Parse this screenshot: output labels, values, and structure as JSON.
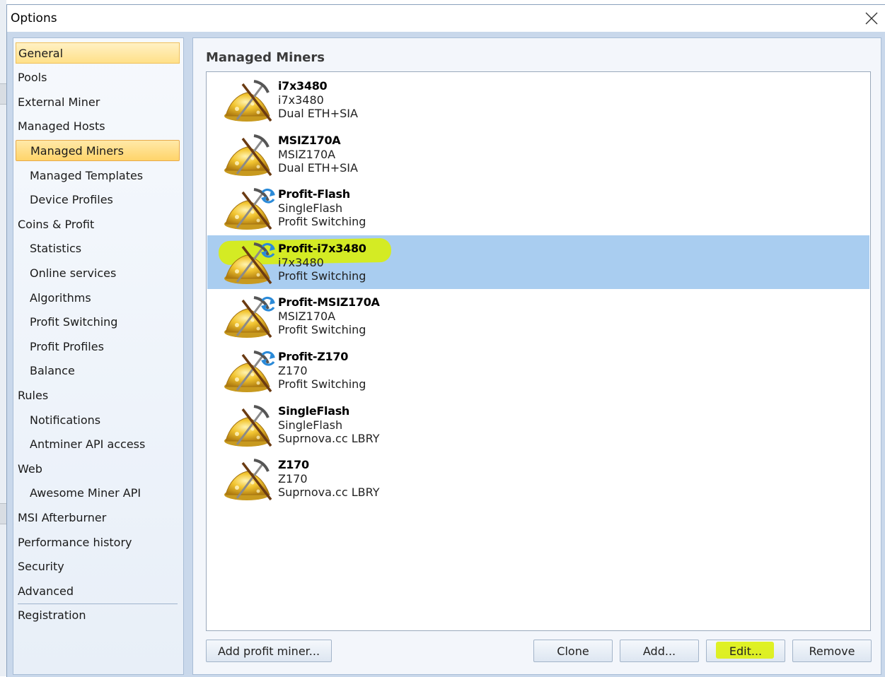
{
  "window": {
    "title": "Options"
  },
  "sidebar": {
    "items": [
      {
        "label": "General",
        "level": 1,
        "state": "current"
      },
      {
        "label": "Pools",
        "level": 1
      },
      {
        "label": "External Miner",
        "level": 1
      },
      {
        "label": "Managed Hosts",
        "level": 1
      },
      {
        "label": "Managed Miners",
        "level": 2,
        "state": "selected"
      },
      {
        "label": "Managed Templates",
        "level": 2
      },
      {
        "label": "Device Profiles",
        "level": 2
      },
      {
        "label": "Coins & Profit",
        "level": 1
      },
      {
        "label": "Statistics",
        "level": 2
      },
      {
        "label": "Online services",
        "level": 2
      },
      {
        "label": "Algorithms",
        "level": 2
      },
      {
        "label": "Profit Switching",
        "level": 2
      },
      {
        "label": "Profit Profiles",
        "level": 2
      },
      {
        "label": "Balance",
        "level": 2
      },
      {
        "label": "Rules",
        "level": 1
      },
      {
        "label": "Notifications",
        "level": 2
      },
      {
        "label": "Antminer API access",
        "level": 2
      },
      {
        "label": "Web",
        "level": 1
      },
      {
        "label": "Awesome Miner API",
        "level": 2
      },
      {
        "label": "MSI Afterburner",
        "level": 1
      },
      {
        "label": "Performance history",
        "level": 1
      },
      {
        "label": "Security",
        "level": 1
      },
      {
        "label": "Advanced",
        "level": 1
      },
      {
        "label": "Registration",
        "level": 1
      }
    ]
  },
  "main": {
    "title": "Managed Miners",
    "miners": [
      {
        "name": "i7x3480",
        "host": "i7x3480",
        "config": "Dual ETH+SIA",
        "profit_switching": false,
        "selected": false
      },
      {
        "name": "MSIZ170A",
        "host": "MSIZ170A",
        "config": "Dual ETH+SIA",
        "profit_switching": false,
        "selected": false
      },
      {
        "name": "Profit-Flash",
        "host": "SingleFlash",
        "config": "Profit Switching",
        "profit_switching": true,
        "selected": false
      },
      {
        "name": "Profit-i7x3480",
        "host": "i7x3480",
        "config": "Profit Switching",
        "profit_switching": true,
        "selected": true
      },
      {
        "name": "Profit-MSIZ170A",
        "host": "MSIZ170A",
        "config": "Profit Switching",
        "profit_switching": true,
        "selected": false
      },
      {
        "name": "Profit-Z170",
        "host": "Z170",
        "config": "Profit Switching",
        "profit_switching": true,
        "selected": false
      },
      {
        "name": "SingleFlash",
        "host": "SingleFlash",
        "config": "Suprnova.cc LBRY",
        "profit_switching": false,
        "selected": false
      },
      {
        "name": "Z170",
        "host": "Z170",
        "config": "Suprnova.cc LBRY",
        "profit_switching": false,
        "selected": false
      }
    ],
    "buttons": {
      "add_profit_miner": "Add profit miner...",
      "clone": "Clone",
      "add": "Add...",
      "edit": "Edit...",
      "remove": "Remove"
    }
  },
  "colors": {
    "selection": "#a9cdf0",
    "highlighter": "#dcf000",
    "nav_selected": "#ffd46a"
  }
}
